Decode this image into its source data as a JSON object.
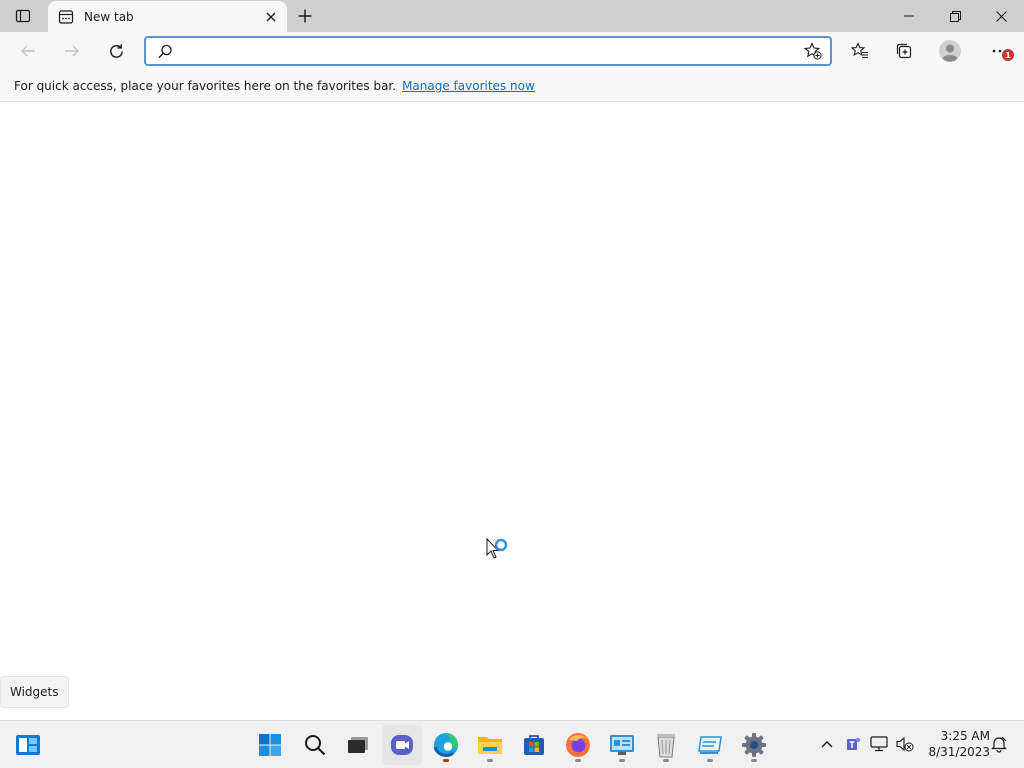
{
  "browser": {
    "tab_title": "New tab",
    "address": {
      "value": "",
      "placeholder": ""
    },
    "favorites_bar": {
      "message": "For quick access, place your favorites here on the favorites bar.",
      "link": "Manage favorites now"
    },
    "notification_count": "1"
  },
  "tooltip": {
    "text": "Widgets"
  },
  "taskbar": {
    "apps": [
      "windows-start",
      "search",
      "task-view",
      "teams-chat",
      "edge",
      "file-explorer",
      "microsoft-store",
      "firefox",
      "control-panel",
      "recycle-bin",
      "network-app",
      "settings"
    ],
    "clock": {
      "time": "3:25 AM",
      "date": "8/31/2023"
    }
  },
  "colors": {
    "accent": "#0f6cbd",
    "address_border": "#5e90cf",
    "badge": "#d13438"
  }
}
